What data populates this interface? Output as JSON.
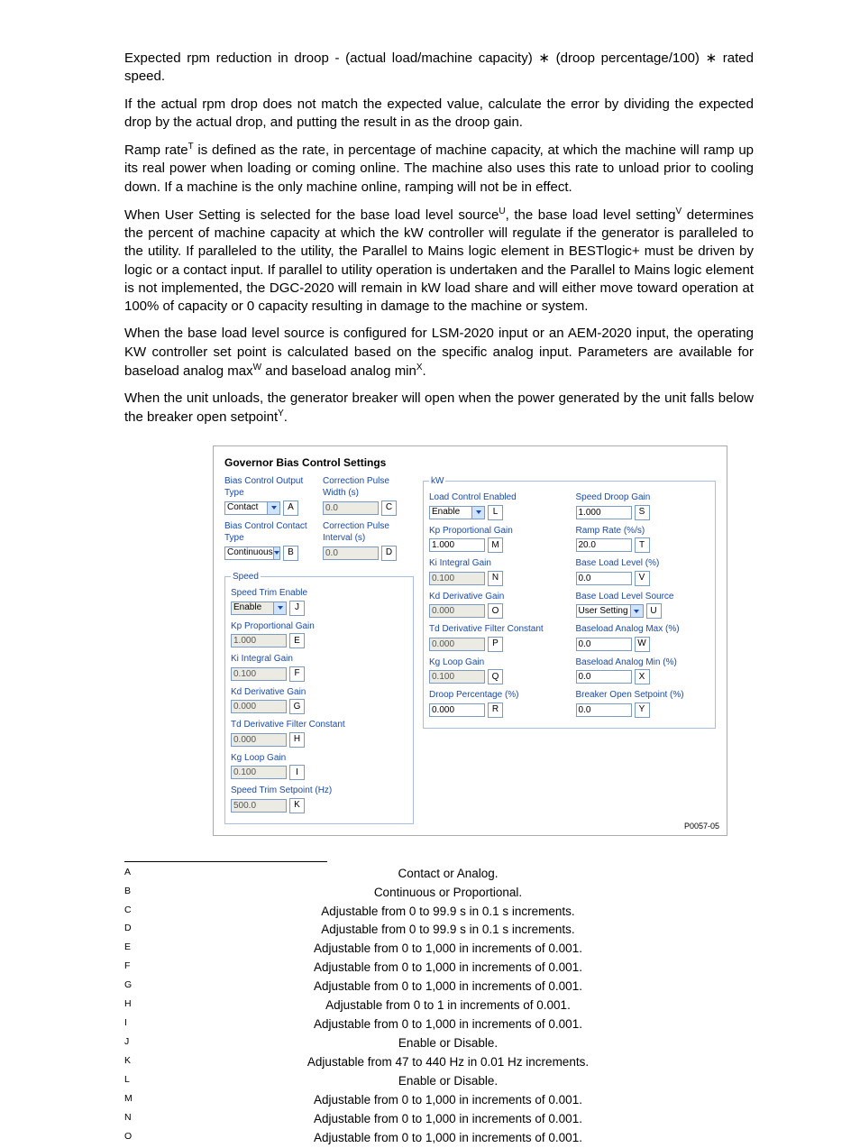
{
  "p1": "Expected rpm reduction in droop - (actual load/machine capacity) ∗ (droop percentage/100) ∗ rated speed.",
  "p2": "If the actual rpm drop does not match the expected value, calculate the error by dividing the expected drop by the actual drop, and putting the result in as the droop gain.",
  "p3a": "Ramp rate",
  "p3b": " is defined as the rate, in percentage of machine capacity, at which the machine will ramp up its real power when loading or coming online. The machine also uses this rate to unload prior to cooling down. If a machine is the only machine online, ramping will not be in effect.",
  "p4a": "When User Setting is selected for the base load level source",
  "p4b": ", the base load level setting",
  "p4c": " determines the percent of machine capacity at which the kW controller will regulate if the generator is paralleled to the utility. If paralleled to the utility, the Parallel to Mains logic element in BESTlogic+ must be driven by logic or a contact input. If parallel to utility operation is undertaken and the Parallel to Mains logic element is not implemented, the DGC-2020 will remain in kW load share and will either move toward operation at 100% of capacity or 0 capacity resulting in damage to the machine or system.",
  "p5a": "When the base load level source is configured for LSM-2020 input or an AEM-2020 input, the operating KW controller set point is calculated based on the specific analog input. Parameters are available for baseload analog max",
  "p5b": " and baseload analog min",
  "p5c": ".",
  "p6a": "When the unit unloads, the generator breaker will open when the power generated by the unit falls below the breaker open setpoint",
  "p6b": ".",
  "sup": {
    "T": "T",
    "U": "U",
    "V": "V",
    "W": "W",
    "X": "X",
    "Y": "Y"
  },
  "fig": {
    "title": "Governor Bias Control Settings",
    "id": "P0057-05",
    "top": {
      "outType": {
        "label": "Bias Control Output Type",
        "value": "Contact",
        "letter": "A"
      },
      "conType": {
        "label": "Bias Control Contact Type",
        "value": "Continuous",
        "letter": "B"
      },
      "pWidth": {
        "label": "Correction Pulse Width (s)",
        "value": "0.0",
        "letter": "C"
      },
      "pInt": {
        "label": "Correction Pulse Interval (s)",
        "value": "0.0",
        "letter": "D"
      }
    },
    "speed": {
      "legend": "Speed",
      "trimEn": {
        "label": "Speed Trim Enable",
        "value": "Enable",
        "letter": "J"
      },
      "kp": {
        "label": "Kp Proportional Gain",
        "value": "1.000",
        "letter": "E"
      },
      "ki": {
        "label": "Ki Integral Gain",
        "value": "0.100",
        "letter": "F"
      },
      "kd": {
        "label": "Kd Derivative Gain",
        "value": "0.000",
        "letter": "G"
      },
      "td": {
        "label": "Td Derivative Filter Constant",
        "value": "0.000",
        "letter": "H"
      },
      "kg": {
        "label": "Kg Loop Gain",
        "value": "0.100",
        "letter": "I"
      },
      "sp": {
        "label": "Speed Trim Setpoint (Hz)",
        "value": "500.0",
        "letter": "K"
      }
    },
    "kw": {
      "legend": "kW",
      "lcEn": {
        "label": "Load Control Enabled",
        "value": "Enable",
        "letter": "L"
      },
      "kp": {
        "label": "Kp Proportional Gain",
        "value": "1.000",
        "letter": "M"
      },
      "ki": {
        "label": "Ki Integral Gain",
        "value": "0.100",
        "letter": "N"
      },
      "kd": {
        "label": "Kd Derivative Gain",
        "value": "0.000",
        "letter": "O"
      },
      "td": {
        "label": "Td Derivative Filter Constant",
        "value": "0.000",
        "letter": "P"
      },
      "kg": {
        "label": "Kg Loop Gain",
        "value": "0.100",
        "letter": "Q"
      },
      "dp": {
        "label": "Droop Percentage (%)",
        "value": "0.000",
        "letter": "R"
      },
      "sdg": {
        "label": "Speed Droop Gain",
        "value": "1.000",
        "letter": "S"
      },
      "rr": {
        "label": "Ramp Rate (%/s)",
        "value": "20.0",
        "letter": "T"
      },
      "bll": {
        "label": "Base Load Level (%)",
        "value": "0.0",
        "letter": "V"
      },
      "bls": {
        "label": "Base Load Level Source",
        "value": "User Setting",
        "letter": "U"
      },
      "bamax": {
        "label": "Baseload Analog Max (%)",
        "value": "0.0",
        "letter": "W"
      },
      "bamin": {
        "label": "Baseload Analog Min (%)",
        "value": "0.0",
        "letter": "X"
      },
      "bos": {
        "label": "Breaker Open Setpoint (%)",
        "value": "0.0",
        "letter": "Y"
      }
    }
  },
  "fn": {
    "A": {
      "l": "A",
      "d": "Contact or Analog."
    },
    "B": {
      "l": "B",
      "d": "Continuous or Proportional."
    },
    "C": {
      "l": "C",
      "d": "Adjustable from 0 to 99.9 s in 0.1 s increments."
    },
    "D": {
      "l": "D",
      "d": "Adjustable from 0 to 99.9 s in 0.1 s increments."
    },
    "E": {
      "l": "E",
      "d": "Adjustable from 0 to 1,000 in increments of 0.001."
    },
    "F": {
      "l": "F",
      "d": "Adjustable from 0 to 1,000 in increments of 0.001."
    },
    "G": {
      "l": "G",
      "d": "Adjustable from 0 to 1,000 in increments of 0.001."
    },
    "H": {
      "l": "H",
      "d": "Adjustable from 0 to 1 in increments of 0.001."
    },
    "I": {
      "l": "I",
      "d": "Adjustable from 0 to 1,000 in increments of 0.001."
    },
    "J": {
      "l": "J",
      "d": "Enable or Disable."
    },
    "K": {
      "l": "K",
      "d": "Adjustable from 47 to 440 Hz in 0.01 Hz increments."
    },
    "L": {
      "l": "L",
      "d": "Enable or Disable."
    },
    "M": {
      "l": "M",
      "d": "Adjustable from 0 to 1,000 in increments of 0.001."
    },
    "N": {
      "l": "N",
      "d": "Adjustable from 0 to 1,000 in increments of 0.001."
    },
    "O": {
      "l": "O",
      "d": "Adjustable from 0 to 1,000 in increments of 0.001."
    }
  }
}
